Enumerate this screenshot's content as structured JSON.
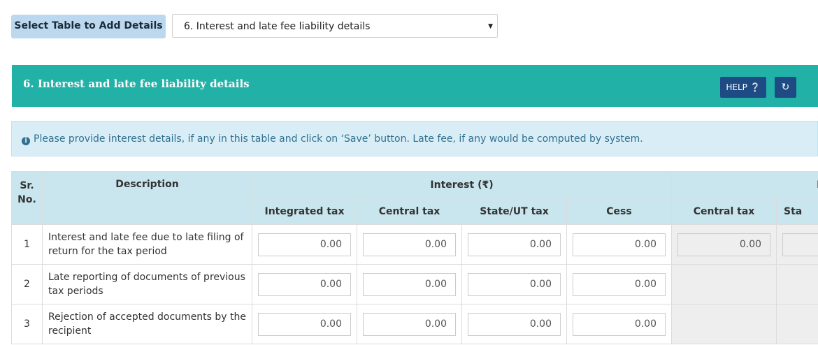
{
  "selector": {
    "label": "Select Table to Add Details",
    "selected": "6. Interest and late fee liability details"
  },
  "section": {
    "title": "6. Interest and late fee liability details",
    "help_label": "HELP",
    "help_icon": "question-circle-icon",
    "refresh_icon": "refresh-icon",
    "accent_color": "#21b1a7",
    "button_color": "#1e4b84"
  },
  "info": {
    "icon": "info-circle-icon",
    "text": "Please provide interest details, if any in this table and click on ‘Save’ button. Late fee, if any would be computed by system."
  },
  "table": {
    "header": {
      "sr_no": "Sr. No.",
      "description": "Description",
      "interest_group": "Interest (₹)",
      "late_fee_group": "Late fee (₹)"
    },
    "columns": [
      "Integrated tax",
      "Central tax",
      "State/UT tax",
      "Cess",
      "Central tax",
      "Sta"
    ],
    "rows": [
      {
        "sr": "1",
        "description": "Interest and late fee due to late filing of return for the tax period",
        "interest": [
          "0.00",
          "0.00",
          "0.00",
          "0.00"
        ],
        "late_fee": [
          "0.00",
          ""
        ]
      },
      {
        "sr": "2",
        "description": "Late reporting of documents of previous tax periods",
        "interest": [
          "0.00",
          "0.00",
          "0.00",
          "0.00"
        ]
      },
      {
        "sr": "3",
        "description": "Rejection of accepted documents by the recipient",
        "interest": [
          "0.00",
          "0.00",
          "0.00",
          "0.00"
        ]
      }
    ]
  }
}
